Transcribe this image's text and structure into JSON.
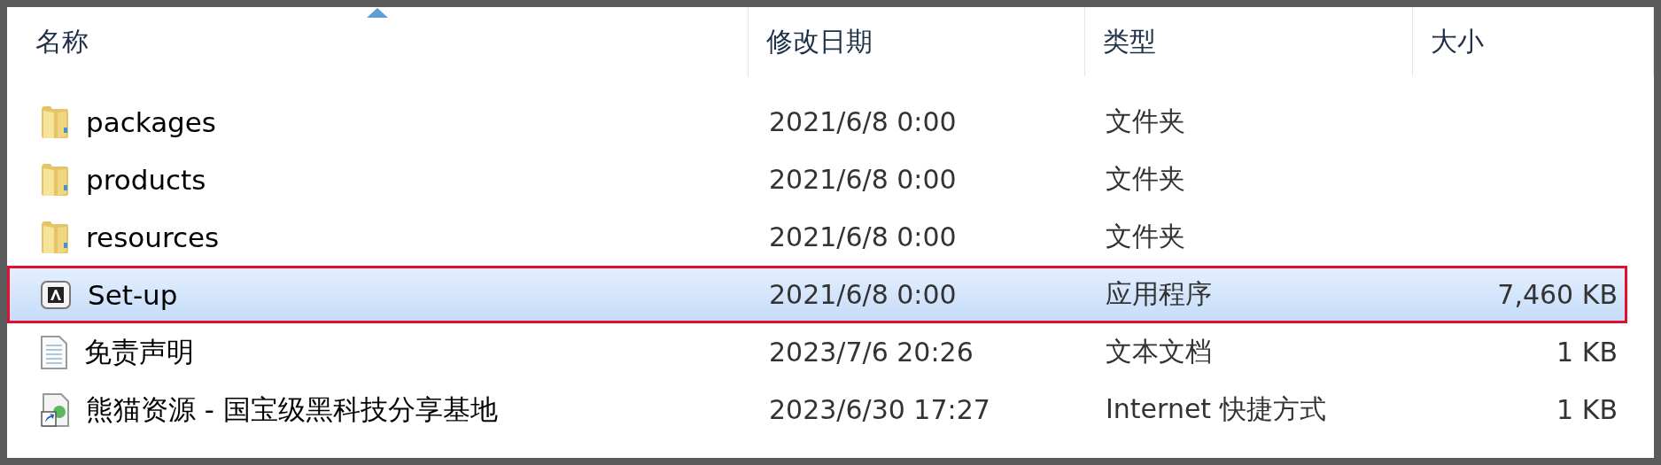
{
  "columns": [
    {
      "label": "名称",
      "sorted": true
    },
    {
      "label": "修改日期",
      "sorted": false
    },
    {
      "label": "类型",
      "sorted": false
    },
    {
      "label": "大小",
      "sorted": false
    }
  ],
  "files": [
    {
      "kind": "folder",
      "name": "packages",
      "modified": "2021/6/8 0:00",
      "type": "文件夹",
      "selected": false,
      "outlined": false
    },
    {
      "kind": "folder",
      "name": "products",
      "modified": "2021/6/8 0:00",
      "type": "文件夹",
      "selected": false,
      "outlined": false
    },
    {
      "kind": "folder",
      "name": "resources",
      "modified": "2021/6/8 0:00",
      "type": "文件夹",
      "selected": false,
      "outlined": false
    },
    {
      "kind": "application",
      "name": "Set-up",
      "modified": "2021/6/8 0:00",
      "type": "应用程序",
      "size": "7,460 KB",
      "selected": true,
      "outlined": true
    },
    {
      "kind": "text",
      "name": "免责声明",
      "modified": "2023/7/6 20:26",
      "type": "文本文档",
      "size": "1 KB",
      "selected": false,
      "outlined": false
    },
    {
      "kind": "shortcut",
      "name": "熊猫资源 - 国宝级黑科技分享基地",
      "modified": "2023/6/30 17:27",
      "type": "Internet 快捷方式",
      "size": "1 KB",
      "selected": false,
      "outlined": false
    }
  ]
}
